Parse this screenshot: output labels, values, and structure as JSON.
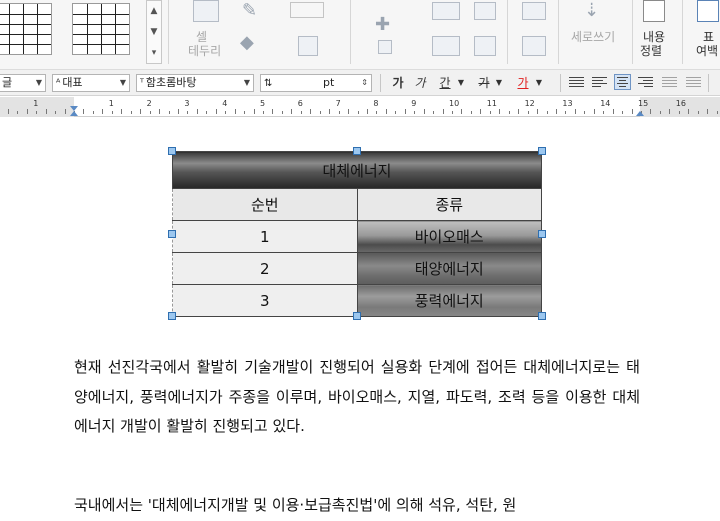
{
  "ribbon": {
    "cell_border_label": "셀\n테두리",
    "cell_border_label_1": "셀",
    "cell_border_label_2": "테두리",
    "vertical_writing_label": "세로쓰기",
    "content_align_label_1": "내용",
    "content_align_label_2": "정렬",
    "table_margin_label_1": "표",
    "table_margin_label_2": "여백"
  },
  "toolbar": {
    "style_value": "글",
    "para_style_value": "대표",
    "font_value": "함초롬바탕",
    "size_unit": "pt",
    "bold_label": "가",
    "italic_label": "가",
    "underline_label": "간",
    "strike_label": "가",
    "color_label": "가"
  },
  "ruler": {
    "numbers": [
      "1",
      "1",
      "2",
      "3",
      "4",
      "5",
      "6",
      "7",
      "8",
      "9",
      "10",
      "11",
      "12",
      "13",
      "14",
      "15",
      "16"
    ]
  },
  "table": {
    "title": "대체에너지",
    "headers": [
      "순번",
      "종류"
    ],
    "rows": [
      [
        "1",
        "바이오매스"
      ],
      [
        "2",
        "태양에너지"
      ],
      [
        "3",
        "풍력에너지"
      ]
    ]
  },
  "body": {
    "paragraph1": "현재 선진각국에서 활발히 기술개발이 진행되어 실용화 단계에 접어든 대체에너지로는 태양에너지, 풍력에너지가 주종을 이루며, 바이오매스, 지열, 파도력, 조력 등을 이용한 대체에너지 개발이 활발히 진행되고 있다.",
    "paragraph2": "국내에서는 '대체에너지개발 및 이용·보급촉진법'에 의해 석유, 석탄, 원"
  },
  "colors": {
    "accent": "#2f6fb0",
    "font_color_underline": "#e02020"
  }
}
